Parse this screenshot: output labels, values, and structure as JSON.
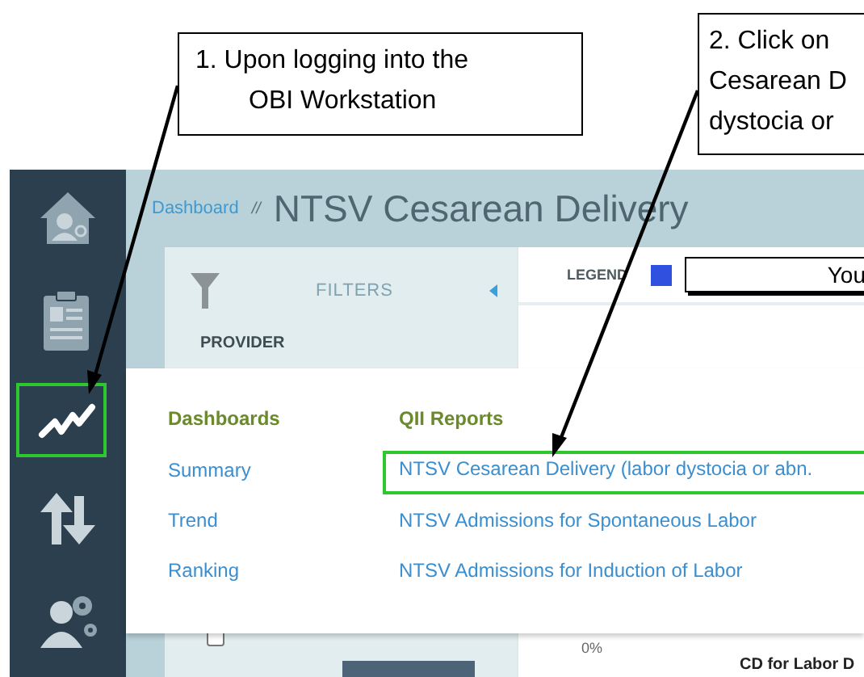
{
  "callouts": [
    {
      "lines": [
        "1.  Upon logging into the",
        "OBI Workstation"
      ]
    },
    {
      "lines": [
        "2. Click on",
        "Cesarean D",
        "dystocia or"
      ]
    }
  ],
  "sidebar": {
    "items": [
      {
        "kind": "home",
        "highlighted": false
      },
      {
        "kind": "clipboard",
        "highlighted": false
      },
      {
        "kind": "trend",
        "highlighted": true
      },
      {
        "kind": "sort",
        "highlighted": false
      },
      {
        "kind": "user-settings",
        "highlighted": false
      }
    ]
  },
  "header": {
    "breadcrumb": "Dashboard",
    "separator": "//",
    "title": "NTSV Cesarean Delivery"
  },
  "filters": {
    "title": "FILTERS",
    "section": "PROVIDER",
    "select_all": {
      "checked": false
    }
  },
  "legend": {
    "label": "LEGEND",
    "items": [
      {
        "label": "You",
        "color": "#3050e0"
      }
    ]
  },
  "menu": {
    "columns": [
      {
        "heading": "Dashboards",
        "items": [
          {
            "label": "Summary",
            "highlighted": false
          },
          {
            "label": "Trend",
            "highlighted": false
          },
          {
            "label": "Ranking",
            "highlighted": false
          }
        ]
      },
      {
        "heading": "QII Reports",
        "items": [
          {
            "label": "NTSV Cesarean Delivery (labor dystocia or abn.",
            "highlighted": true
          },
          {
            "label": "NTSV Admissions for Spontaneous Labor",
            "highlighted": false
          },
          {
            "label": "NTSV Admissions for Induction of Labor",
            "highlighted": false
          }
        ]
      }
    ]
  },
  "chart": {
    "axis_label": "0%",
    "title": "CD for Labor D"
  }
}
